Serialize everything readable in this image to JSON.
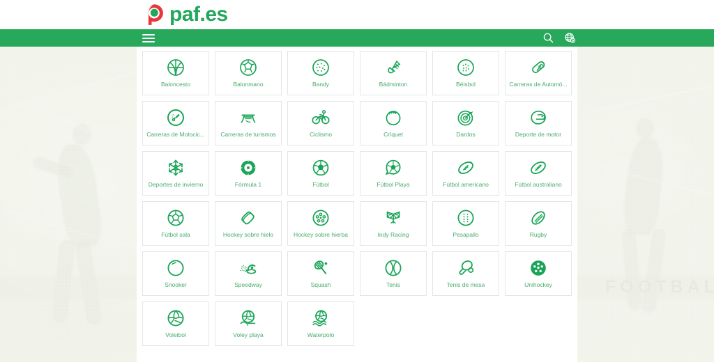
{
  "brand": {
    "logo_text": "paf.es",
    "logo_mark_icon": "paf-circle-logo-icon",
    "green": "#22a75d",
    "red": "#e8373c"
  },
  "navbar": {
    "background": "#28a85b",
    "menu_icon": "hamburger-menu-icon",
    "search_icon": "search-icon",
    "language_icon": "globe-language-icon"
  },
  "background": {
    "banner_text": "FOOTBALL"
  },
  "sports": [
    {
      "label": "Baloncesto",
      "icon": "basketball-icon"
    },
    {
      "label": "Balonmano",
      "icon": "handball-icon"
    },
    {
      "label": "Bandy",
      "icon": "bandy-ball-icon"
    },
    {
      "label": "Bádminton",
      "icon": "shuttlecock-icon"
    },
    {
      "label": "Béisbol",
      "icon": "baseball-icon"
    },
    {
      "label": "Carreras de Automó...",
      "icon": "race-car-icon"
    },
    {
      "label": "Carreras de Motocic...",
      "icon": "motorcycle-racing-icon"
    },
    {
      "label": "Carreras de turismos",
      "icon": "touring-car-icon"
    },
    {
      "label": "Ciclismo",
      "icon": "cycling-icon"
    },
    {
      "label": "Críquet",
      "icon": "cricket-ball-icon"
    },
    {
      "label": "Dardos",
      "icon": "darts-target-icon"
    },
    {
      "label": "Deporte de motor",
      "icon": "motorsport-helmet-icon"
    },
    {
      "label": "Deportes de invierno",
      "icon": "snowflake-icon"
    },
    {
      "label": "Fórmula 1",
      "icon": "formula-one-tyre-icon"
    },
    {
      "label": "Fútbol",
      "icon": "football-icon"
    },
    {
      "label": "Fútbol Playa",
      "icon": "beach-soccer-icon"
    },
    {
      "label": "Fútbol americano",
      "icon": "american-football-icon"
    },
    {
      "label": "Fútbol australiano",
      "icon": "australian-football-icon"
    },
    {
      "label": "Fútbol sala",
      "icon": "futsal-ball-icon"
    },
    {
      "label": "Hockey sobre hielo",
      "icon": "ice-hockey-puck-icon"
    },
    {
      "label": "Hockey sobre hierba",
      "icon": "field-hockey-ball-icon"
    },
    {
      "label": "Indy Racing",
      "icon": "checkered-flags-icon"
    },
    {
      "label": "Pesapallo",
      "icon": "pesapallo-ball-icon"
    },
    {
      "label": "Rugby",
      "icon": "rugby-ball-icon"
    },
    {
      "label": "Snooker",
      "icon": "snooker-ball-icon"
    },
    {
      "label": "Speedway",
      "icon": "speedway-bike-icon"
    },
    {
      "label": "Squash",
      "icon": "squash-racket-icon"
    },
    {
      "label": "Tenis",
      "icon": "tennis-ball-icon"
    },
    {
      "label": "Tenis de mesa",
      "icon": "table-tennis-paddle-icon"
    },
    {
      "label": "Unihockey",
      "icon": "unihockey-ball-icon"
    },
    {
      "label": "Voleibol",
      "icon": "volleyball-icon"
    },
    {
      "label": "Voley playa",
      "icon": "beach-volleyball-icon"
    },
    {
      "label": "Waterpolo",
      "icon": "waterpolo-ball-icon"
    }
  ]
}
